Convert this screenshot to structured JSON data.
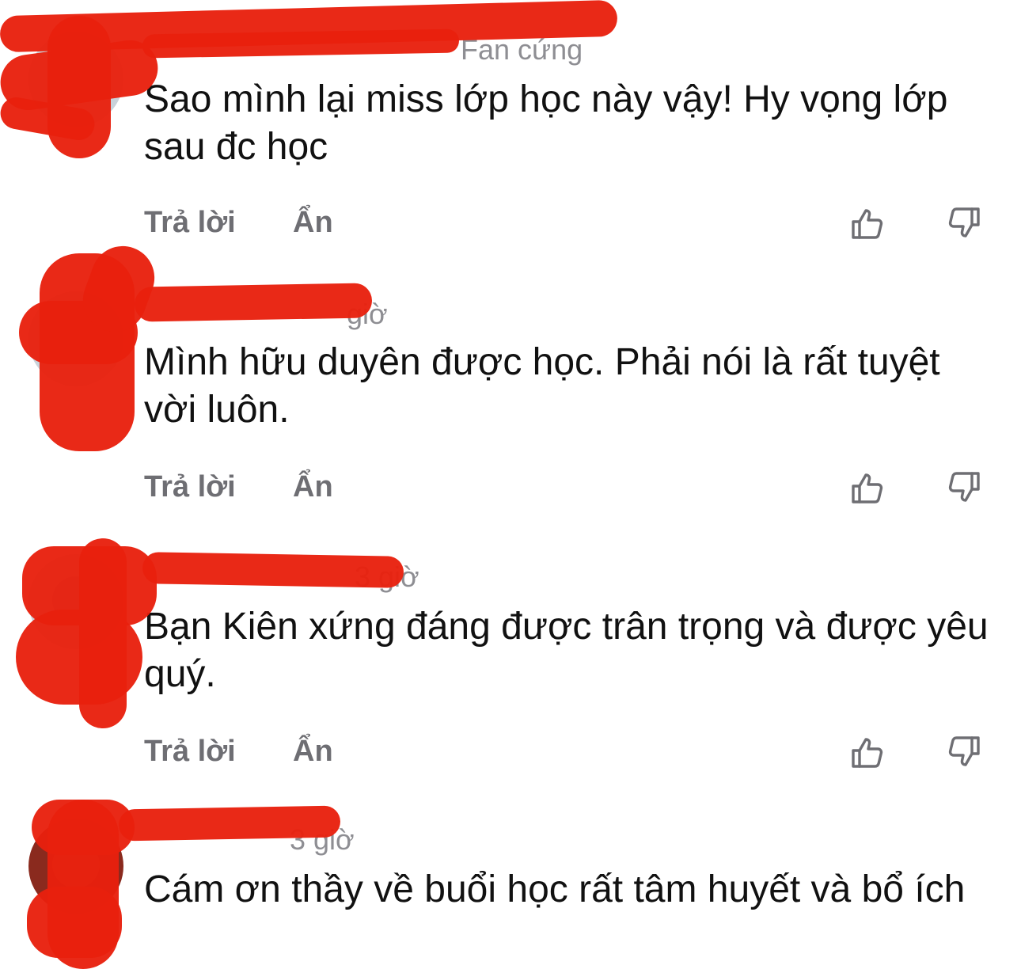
{
  "colors": {
    "text": "#111111",
    "secondary": "#8e8e93",
    "action": "#6e6e73",
    "redaction": "#e8200e"
  },
  "comments": [
    {
      "author": "",
      "time": "Fan cứng",
      "text": "Sao mình lại miss lớp học này vậy! Hy vọng lớp sau đc học",
      "reply_label": "Trả lời",
      "hide_label": "Ẩn",
      "like_icon": "thumbs-up-icon",
      "dislike_icon": "thumbs-down-icon"
    },
    {
      "author": "",
      "time": "giờ",
      "text": "Mình hữu duyên được học. Phải nói là rất tuyệt vời luôn.",
      "reply_label": "Trả lời",
      "hide_label": "Ẩn",
      "like_icon": "thumbs-up-icon",
      "dislike_icon": "thumbs-down-icon"
    },
    {
      "author": "",
      "time": "3 giờ",
      "text": "Bạn Kiên xứng đáng được trân trọng và được yêu quý.",
      "reply_label": "Trả lời",
      "hide_label": "Ẩn",
      "like_icon": "thumbs-up-icon",
      "dislike_icon": "thumbs-down-icon"
    },
    {
      "author": "",
      "time": "3 giờ",
      "text": "Cám ơn thầy về buổi học rất tâm huyết và bổ ích"
    }
  ]
}
